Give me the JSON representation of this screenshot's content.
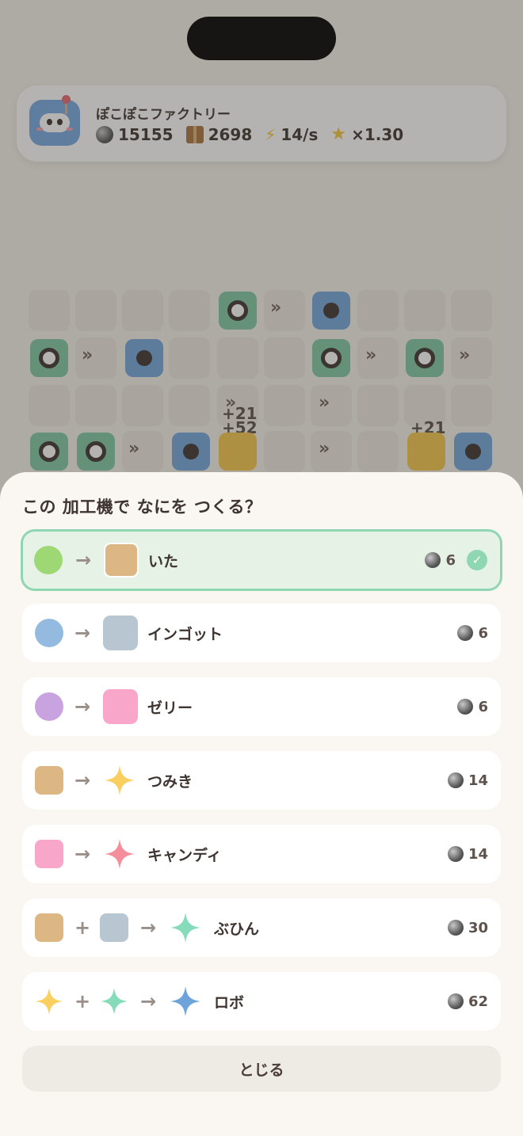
{
  "header": {
    "app_name": "ぽこぽこファクトリー",
    "stats": [
      {
        "icon": "coin-icon",
        "value": "15155"
      },
      {
        "icon": "box-icon",
        "value": "2698"
      },
      {
        "icon": "bolt-icon",
        "value": "14/s"
      },
      {
        "icon": "star-icon",
        "value": "×1.30"
      }
    ]
  },
  "board": {
    "floating_texts": [
      "+21",
      "+52",
      "+21"
    ]
  },
  "sheet": {
    "title": "この 加工機で なにを つくる？",
    "recipes": [
      {
        "name": "いた",
        "cost": "6",
        "selected": true
      },
      {
        "name": "インゴット",
        "cost": "6"
      },
      {
        "name": "ゼリー",
        "cost": "6"
      },
      {
        "name": "つみき",
        "cost": "14"
      },
      {
        "name": "キャンディ",
        "cost": "14"
      },
      {
        "name": "ぶひん",
        "cost": "30"
      },
      {
        "name": "ロボ",
        "cost": "62"
      }
    ],
    "arrow": "→",
    "plus": "+",
    "check": "✓",
    "close_label": "とじる"
  },
  "colors": {
    "green": "#9ed874",
    "blue": "#94badf",
    "purple": "#c9a3e0",
    "tan": "#dcb683",
    "steel": "#b8c6d2",
    "pink": "#f8a6c9",
    "yellow_star": "#f9cf60",
    "red_star": "#f48e9b",
    "mint_star": "#86dbbb",
    "blue_star": "#6fa3dc"
  }
}
